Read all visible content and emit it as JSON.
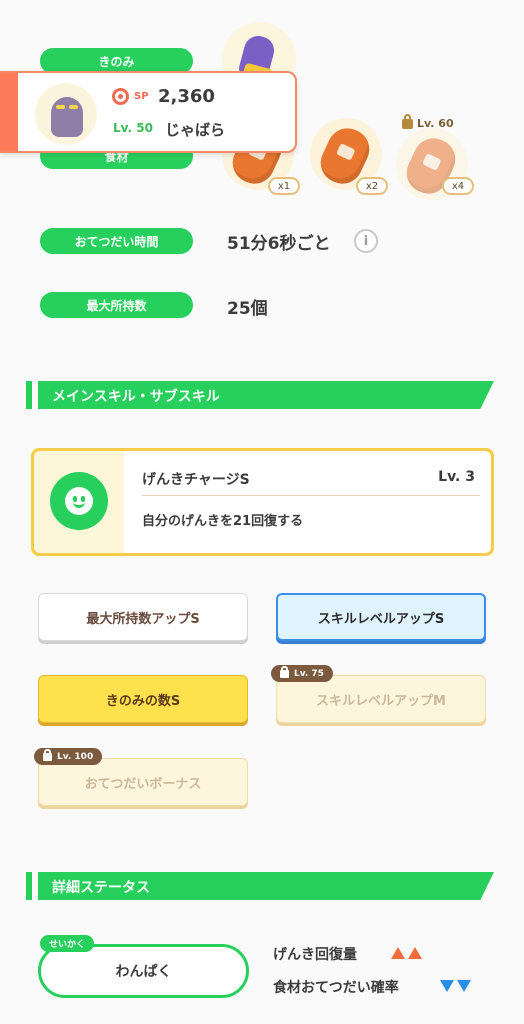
{
  "info": {
    "berry_label": "きのみ",
    "ingredient_label": "食材",
    "help_time_label": "おてつだい時間",
    "help_time_value": "51分6秒ごと",
    "info_icon": "i",
    "carry_label": "最大所持数",
    "carry_value": "25個"
  },
  "ingredients": [
    {
      "count": "x1"
    },
    {
      "count": "x2"
    },
    {
      "count": "x4",
      "lock": "Lv. 60"
    }
  ],
  "popup": {
    "sp_label": "SP",
    "sp_value": "2,360",
    "level": "Lv. 50",
    "name": "じゃばら"
  },
  "sections": {
    "skills": "メインスキル・サブスキル",
    "details": "詳細ステータス"
  },
  "main_skill": {
    "name": "げんきチャージS",
    "level": "Lv. 3",
    "description": "自分のげんきを21回復する"
  },
  "sub_skills": [
    {
      "label": "最大所持数アップS"
    },
    {
      "label": "スキルレベルアップS"
    },
    {
      "label": "きのみの数S"
    },
    {
      "label": "スキルレベルアップM",
      "lock": "Lv. 75"
    },
    {
      "label": "おてつだいボーナス",
      "lock": "Lv. 100"
    }
  ],
  "nature": {
    "tag": "せいかく",
    "value": "わんぱく",
    "up_label": "げんき回復量",
    "down_label": "食材おてつだい確率"
  },
  "colors": {
    "green": "#27d05c",
    "accent_orange": "#ff7a58",
    "gold": "#f6cd4a",
    "blue": "#3a8ee8"
  }
}
